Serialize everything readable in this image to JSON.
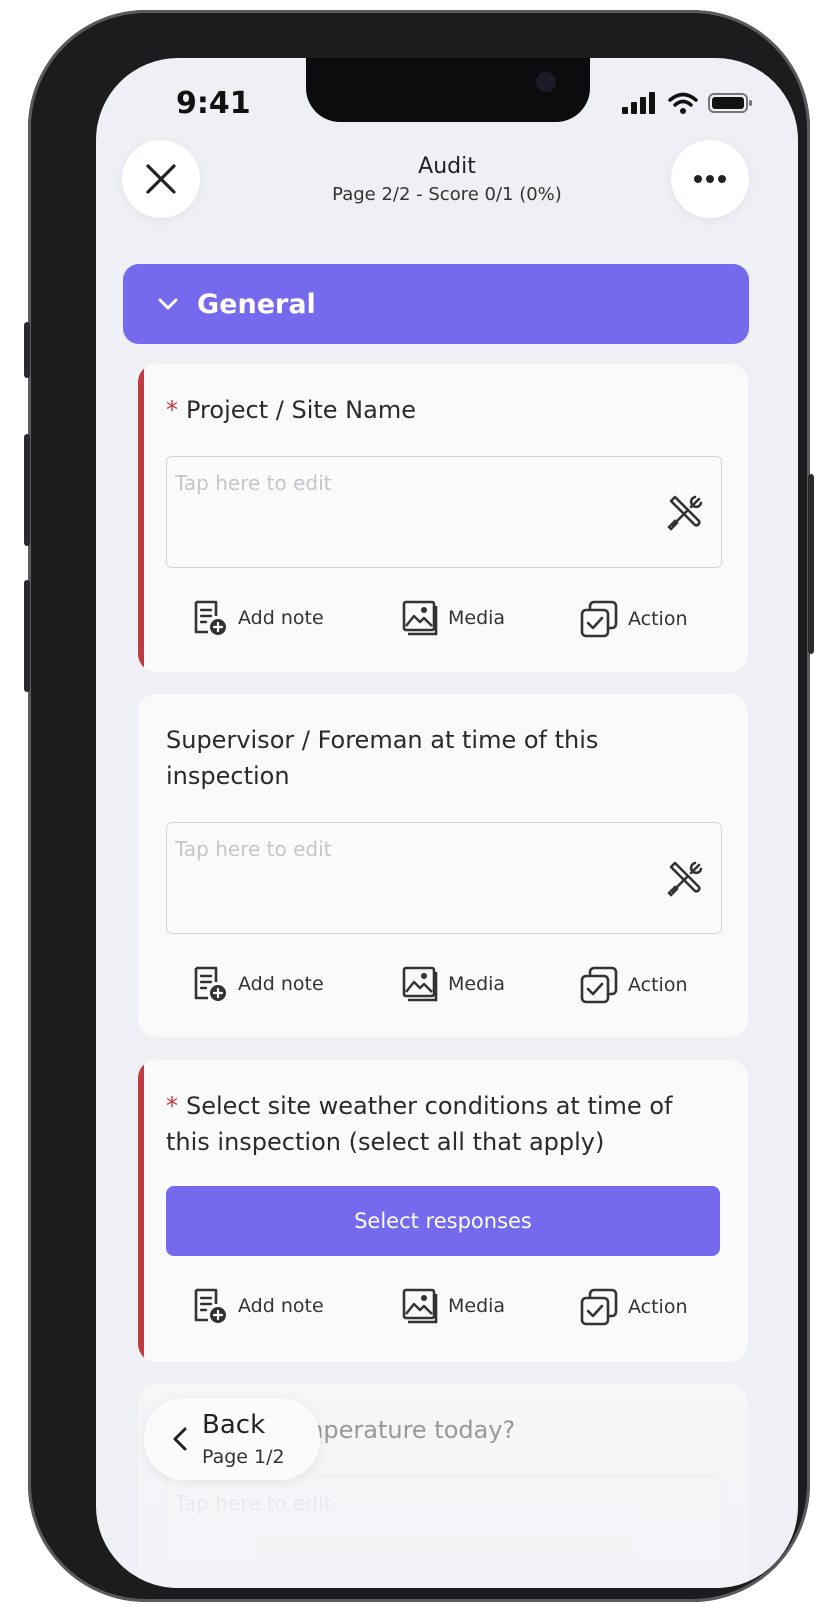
{
  "status_bar": {
    "time": "9:41"
  },
  "header": {
    "title": "Audit",
    "subtitle": "Page 2/2 - Score 0/1 (0%)"
  },
  "section": {
    "label": "General"
  },
  "questions": [
    {
      "label": "Project / Site Name",
      "required": true,
      "placeholder": "Tap here to edit"
    },
    {
      "label_line1": "Supervisor / Foreman at time of this",
      "label_line2": "inspection",
      "required": false,
      "placeholder": "Tap here to edit"
    },
    {
      "label_line1": "Select site weather conditions at time of",
      "label_line2": "this inspection (select all that apply)",
      "required": true,
      "button_label": "Select responses"
    },
    {
      "label_partial": "mperature today?",
      "placeholder": "Tap here to edit"
    }
  ],
  "actions": {
    "add_note": "Add note",
    "media": "Media",
    "action": "Action"
  },
  "back": {
    "label": "Back",
    "page": "Page 1/2"
  },
  "colors": {
    "accent": "#7569ee",
    "required": "#c03a44",
    "background": "#eef0f5"
  }
}
